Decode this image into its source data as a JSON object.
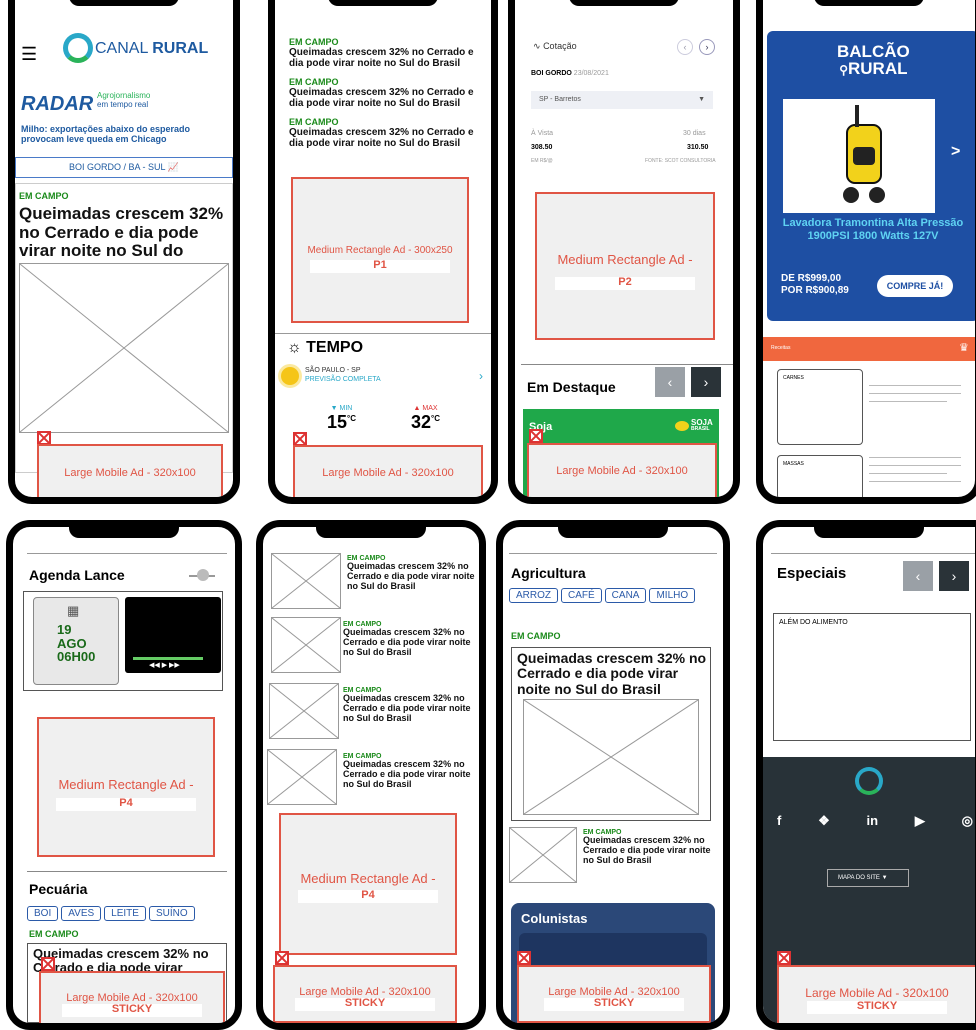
{
  "p1": {
    "logo_canal": "CANAL",
    "logo_rural": "RURAL",
    "radar": "RADAR",
    "radar_sub1": "Agrojornalismo",
    "radar_sub2": "em tempo real",
    "radar_news": "Milho: exportações abaixo do esperado provocam leve queda em Chicago",
    "ticker": "BOI GORDO / BA - SUL",
    "section": "EM CAMPO",
    "headline": "Queimadas crescem 32% no Cerrado e dia pode virar noite no Sul do Brasil",
    "ad": "Large Mobile Ad - 320x100"
  },
  "p2": {
    "items": [
      {
        "section": "EM CAMPO",
        "headline": "Queimadas crescem 32% no Cerrado e dia pode virar noite no Sul do Brasil"
      },
      {
        "section": "EM CAMPO",
        "headline": "Queimadas crescem 32% no Cerrado e dia pode virar noite no Sul do Brasil"
      },
      {
        "section": "EM CAMPO",
        "headline": "Queimadas crescem 32% no Cerrado e dia pode virar noite no Sul do Brasil"
      }
    ],
    "ad_medium": "Medium Rectangle Ad - 300x250",
    "ad_medium_pos": "P1",
    "weather_title": "TEMPO",
    "city": "SÃO PAULO - SP",
    "forecast": "PREVISÃO COMPLETA",
    "min_label": "MIN",
    "min_val": "15",
    "max_label": "MAX",
    "max_val": "32",
    "deg": "°C",
    "ad": "Large Mobile Ad - 320x100"
  },
  "p3": {
    "title": "Cotação",
    "commodity": "BOI GORDO",
    "date": "23/08/2021",
    "select": "SP - Barretos",
    "col1": "À Vista",
    "col2": "30 dias",
    "val1": "308.50",
    "val2": "310.50",
    "unit": "EM R$/@",
    "source": "FONTE: SCOT CONSULTORIA",
    "ad_medium": "Medium Rectangle Ad -",
    "ad_medium_pos": "P2",
    "destaque": "Em Destaque",
    "card": "Soja",
    "card_logo": "SOJA",
    "card_logo2": "BRASIL",
    "ad": "Large Mobile Ad - 320x100"
  },
  "p4": {
    "balcao": "BALCÃO",
    "rural": "RURAL",
    "product": "Lavadora Tramontina Alta Pressão 1900PSI 1800 Watts 127V",
    "price_from": "DE R$999,00",
    "price_to": "POR R$900,89",
    "cta": "COMPRE JÁ!",
    "recipe_title": "Receitas",
    "cat1": "CARNES",
    "cat2": "MASSAS"
  },
  "p5": {
    "title": "Agenda Lance",
    "day": "19",
    "month": "AGO",
    "time": "06H00",
    "ad_medium": "Medium Rectangle Ad -",
    "ad_medium_pos": "P4",
    "pecuaria": "Pecuária",
    "tags": [
      "BOI",
      "AVES",
      "LEITE",
      "SUÍNO"
    ],
    "section": "EM CAMPO",
    "headline": "Queimadas crescem 32% no Cerrado e dia pode virar",
    "ad": "Large Mobile Ad - 320x100",
    "sticky": "STICKY"
  },
  "p6": {
    "items": [
      {
        "section": "EM CAMPO",
        "headline": "Queimadas crescem 32% no Cerrado e dia pode virar noite no Sul do Brasil"
      },
      {
        "section": "EM CAMPO",
        "headline": "Queimadas crescem 32% no Cerrado e dia pode virar noite no Sul do Brasil"
      },
      {
        "section": "EM CAMPO",
        "headline": "Queimadas crescem 32% no Cerrado e dia pode virar noite no Sul do Brasil"
      },
      {
        "section": "EM CAMPO",
        "headline": "Queimadas crescem 32% no Cerrado e dia pode virar noite no Sul do Brasil"
      }
    ],
    "ad_medium": "Medium Rectangle Ad -",
    "ad_medium_pos": "P4",
    "ad": "Large Mobile Ad - 320x100",
    "sticky": "STICKY"
  },
  "p7": {
    "title": "Agricultura",
    "tags": [
      "ARROZ",
      "CAFÉ",
      "CANA",
      "MILHO"
    ],
    "section": "EM CAMPO",
    "headline": "Queimadas crescem 32% no Cerrado e dia pode virar noite no Sul do Brasil",
    "section2": "EM CAMPO",
    "headline2": "Queimadas crescem 32% no Cerrado e dia pode virar noite no Sul do Brasil",
    "colunistas": "Colunistas",
    "ad": "Large Mobile Ad - 320x100",
    "sticky": "STICKY"
  },
  "p8": {
    "title": "Especiais",
    "card": "ALÉM DO ALIMENTO",
    "sitemap": "MAPA DO SITE",
    "ad": "Large Mobile Ad - 320x100",
    "sticky": "STICKY"
  }
}
